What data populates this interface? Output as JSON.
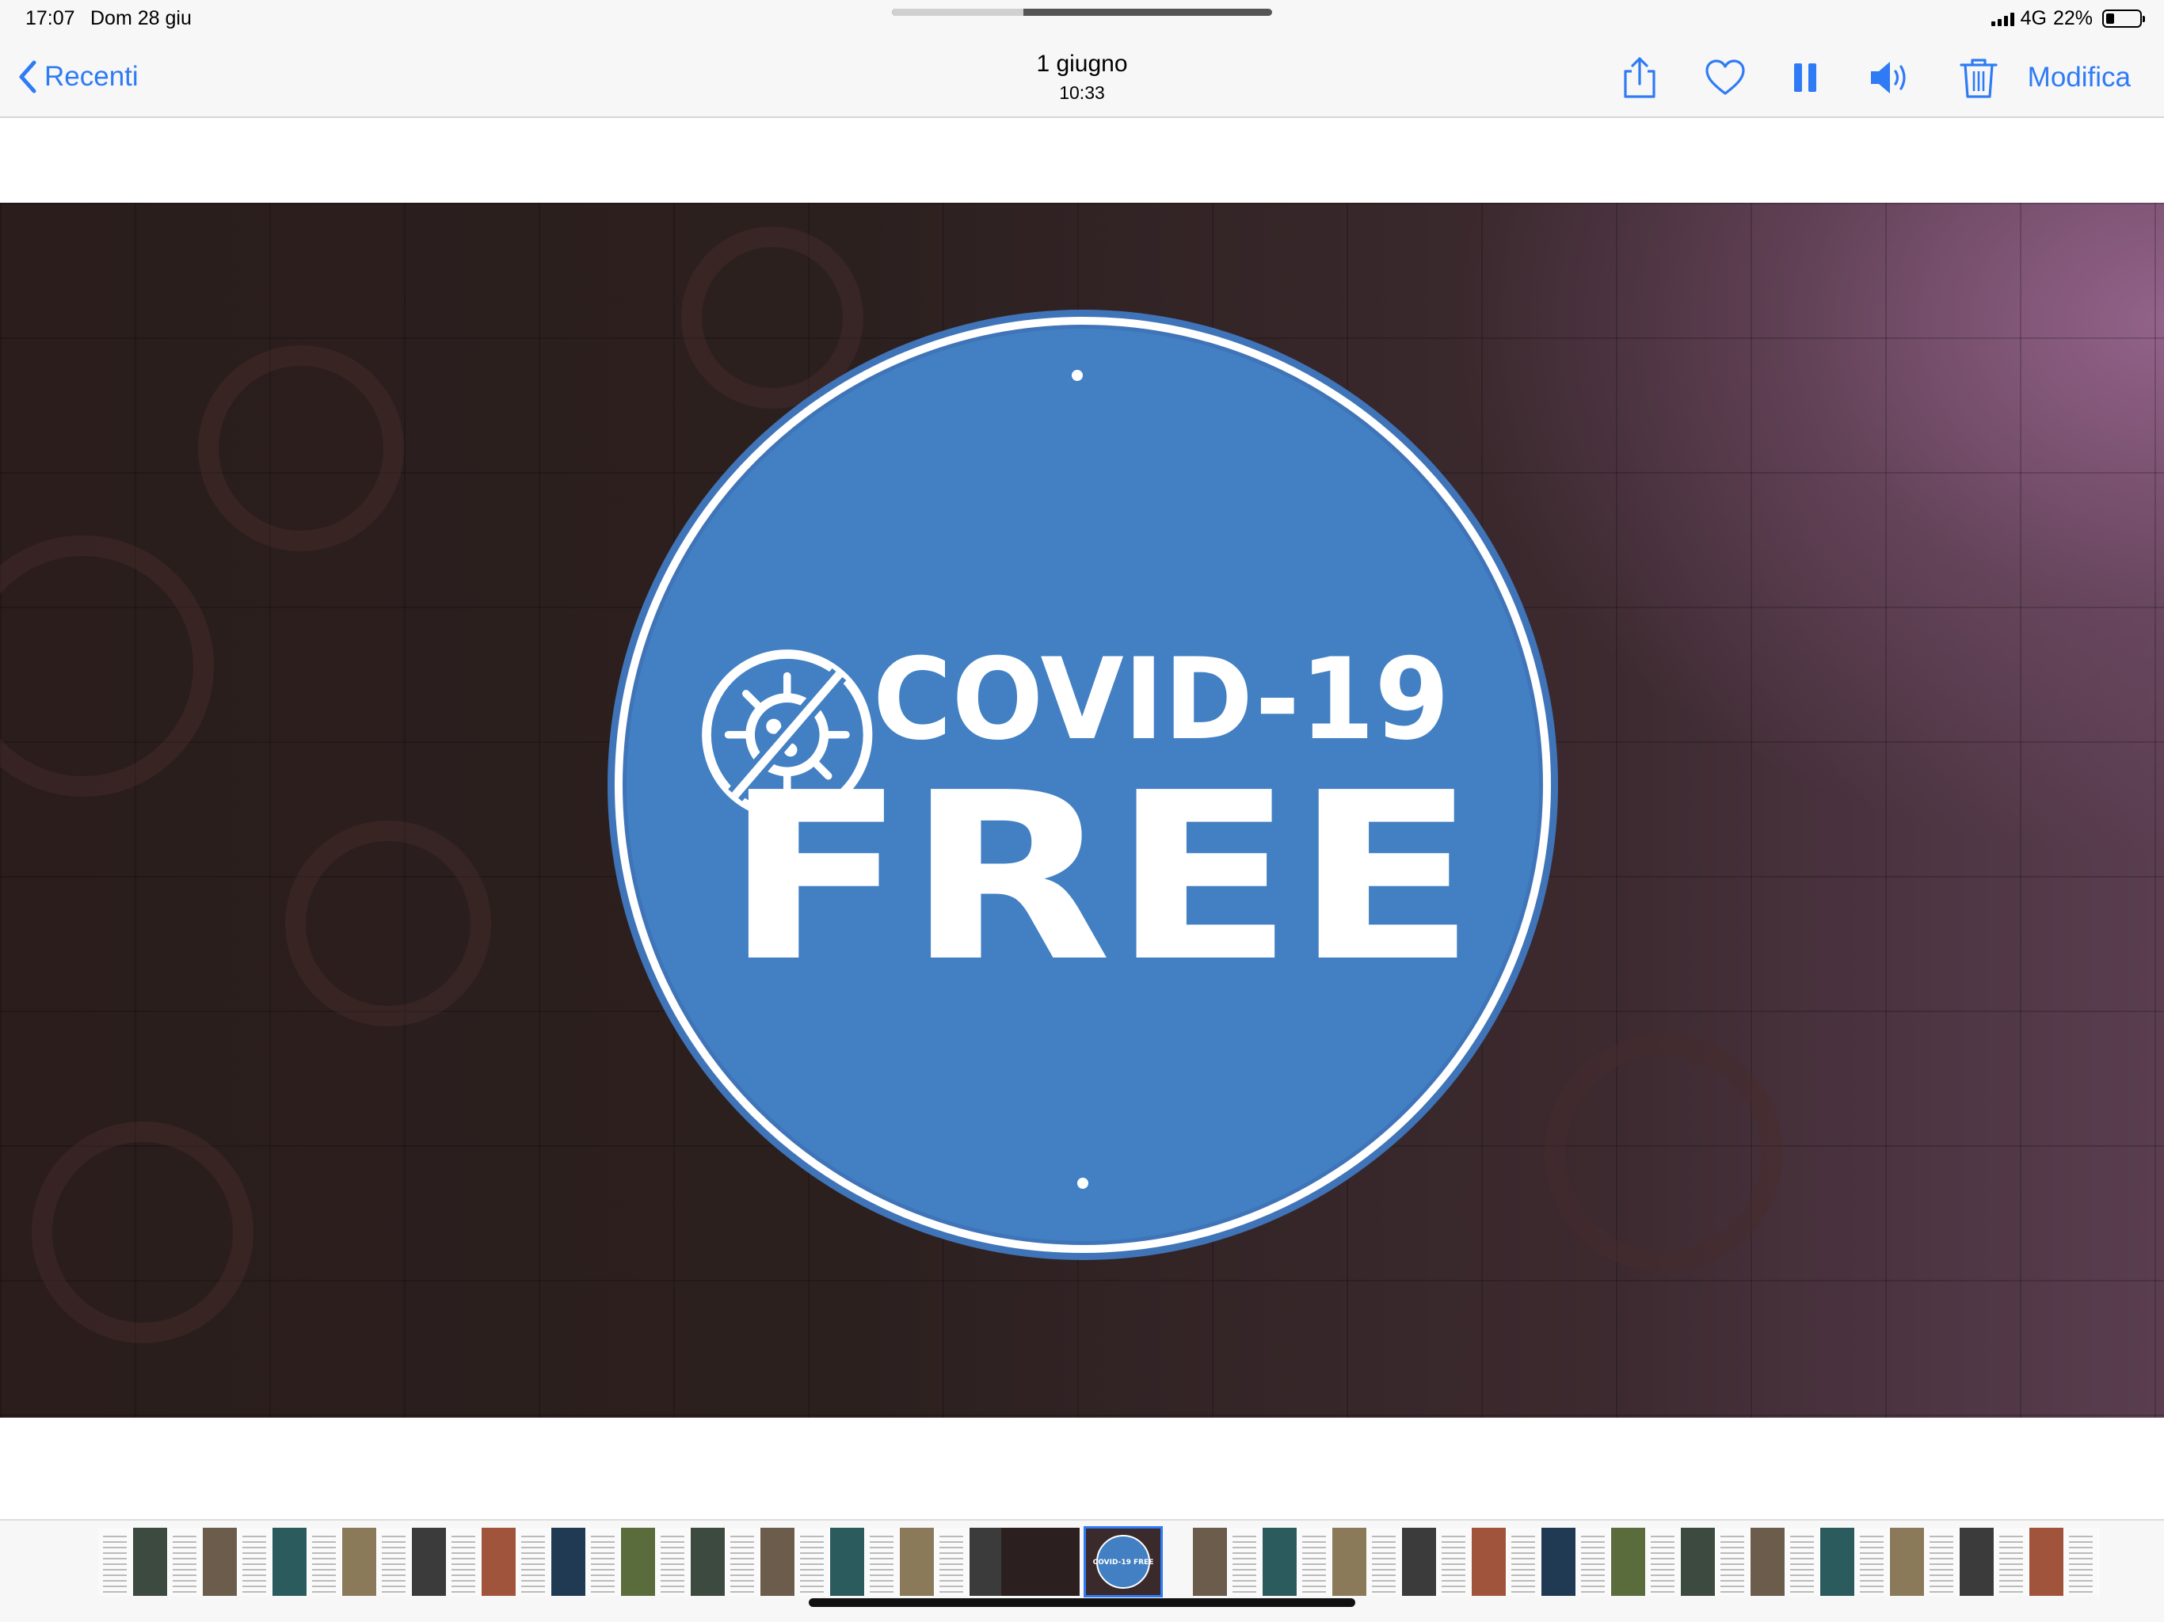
{
  "status_bar": {
    "time": "17:07",
    "date": "Dom 28 giu",
    "network": "4G",
    "battery": "22%",
    "battery_level": 0.22
  },
  "nav": {
    "back_label": "Recenti",
    "title": "1 giugno",
    "subtitle": "10:33",
    "edit_label": "Modifica",
    "icons": [
      "share-icon",
      "heart-icon",
      "pause-icon",
      "speaker-icon",
      "trash-icon"
    ]
  },
  "photo": {
    "sign_line1": "COVID-19",
    "sign_line2": "FREE",
    "sign_color": "#4280c3"
  },
  "thumbnail_strip": {
    "selected_thumb_text": "COVID-19 FREE"
  },
  "colors": {
    "accent": "#2f7bf5",
    "bar_background": "#f7f7f7"
  }
}
